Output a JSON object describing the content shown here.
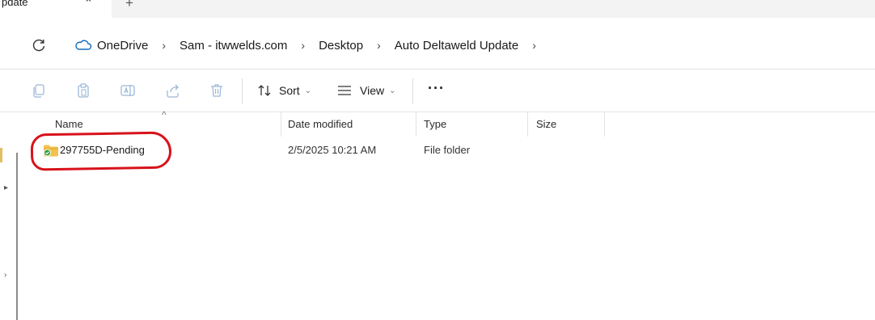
{
  "tab": {
    "title": "pdate",
    "close_glyph": "⌃",
    "new_glyph": "+"
  },
  "address": {
    "refresh_icon": "refresh-icon",
    "root_icon": "cloud-icon",
    "crumbs": [
      "OneDrive",
      "Sam - itwwelds.com",
      "Desktop",
      "Auto Deltaweld Update"
    ],
    "separator": "›"
  },
  "commandbar": {
    "icons": [
      "copy-icon",
      "paste-icon",
      "rename-icon",
      "share-icon",
      "delete-icon"
    ],
    "sort_label": "Sort",
    "view_label": "View",
    "more_label": "···"
  },
  "columns": {
    "name": "Name",
    "date": "Date modified",
    "type": "Type",
    "size": "Size",
    "sort_caret": "^"
  },
  "files": [
    {
      "name": "297755D-Pending",
      "date": "2/5/2025 10:21 AM",
      "type": "File folder",
      "size": "",
      "icon": "synced-folder-icon",
      "status_color": "#2e9e3e"
    }
  ],
  "colors": {
    "annotation": "#d8121a",
    "folder": "#f2c14e",
    "accent": "#0f6cbd"
  },
  "nav": {
    "marks": [
      "▸",
      "›"
    ]
  }
}
